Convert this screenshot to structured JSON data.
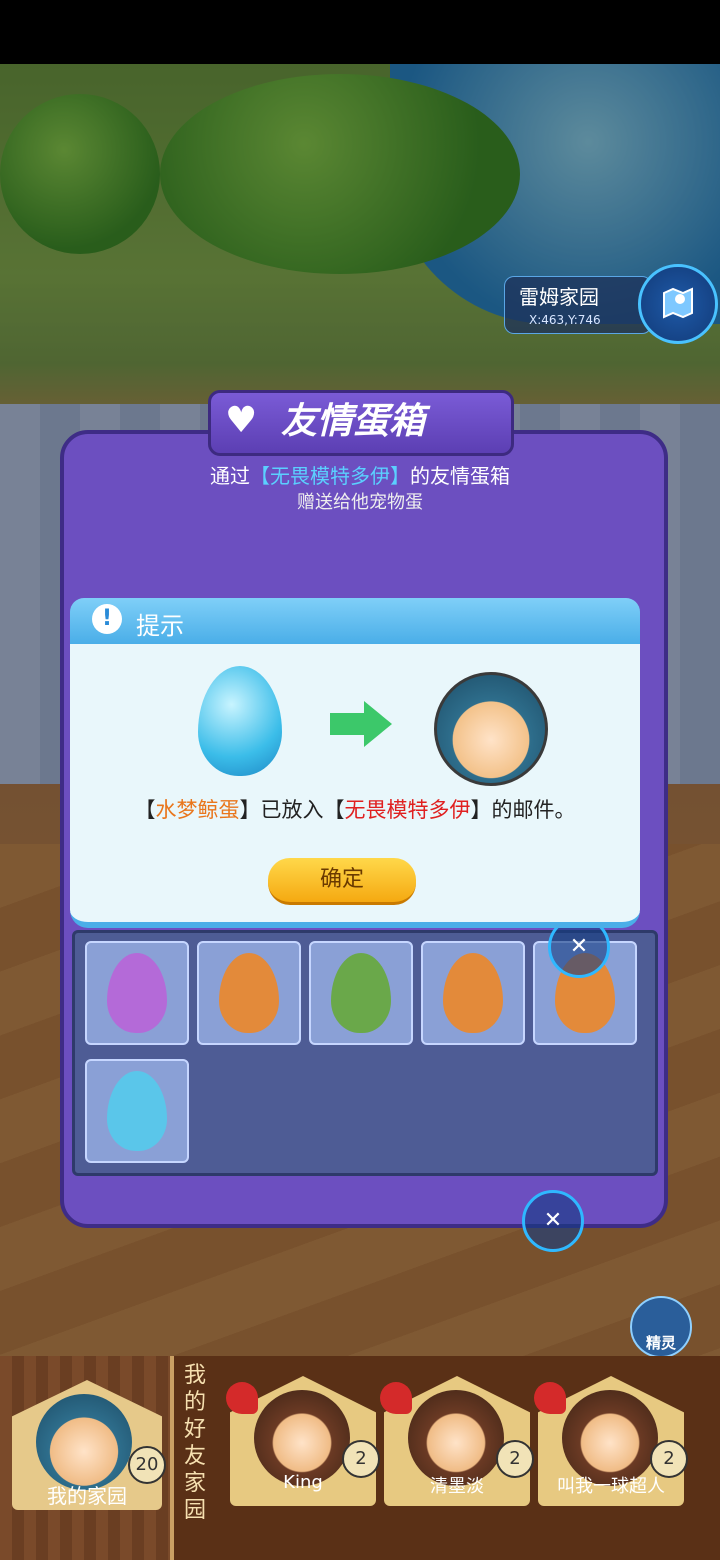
{
  "location": {
    "name": "雷姆家园",
    "coords": "X:463,Y:746"
  },
  "friendship_box": {
    "title": "友情蛋箱",
    "desc_prefix": "通过",
    "desc_name": "【无畏模特多伊】",
    "desc_suffix": "的友情蛋箱",
    "subtitle": "赠送给他宠物蛋",
    "eggs": [
      {
        "name": "purple-winged-egg",
        "color": "#b46ad8"
      },
      {
        "name": "orange-egg",
        "color": "#e38a3a"
      },
      {
        "name": "green-egg",
        "color": "#6aa84a"
      },
      {
        "name": "orange-egg",
        "color": "#e38a3a"
      },
      {
        "name": "orange-egg",
        "color": "#e38a3a"
      },
      {
        "name": "blue-whale-egg",
        "color": "#5ac6ea"
      }
    ]
  },
  "dialog": {
    "title": "提示",
    "icon": "alert-icon",
    "msg_open1": "【",
    "egg_name": "水梦鲸蛋",
    "msg_mid": "】已放入【",
    "player_name": "无畏模特多伊",
    "msg_end": "】的邮件。",
    "confirm_label": "确定"
  },
  "sprite_button": {
    "label": "精灵"
  },
  "my_home": {
    "label": "我的家园",
    "count": "20"
  },
  "friends": {
    "title": "我的好友家园",
    "items": [
      {
        "name": "King",
        "count": "2"
      },
      {
        "name": "清墨淡",
        "count": "2"
      },
      {
        "name": "叫我一球超人",
        "count": "2"
      }
    ]
  }
}
